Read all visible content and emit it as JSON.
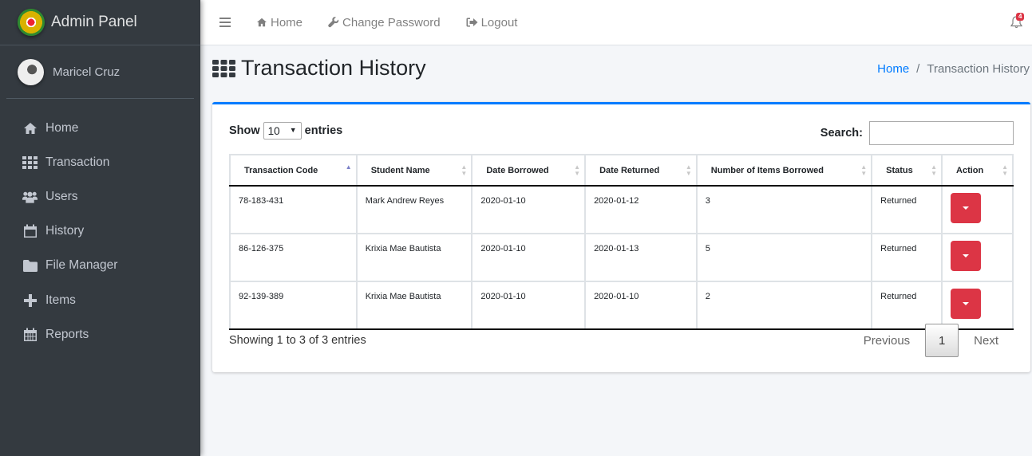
{
  "brand": {
    "title": "Admin Panel",
    "logo": "school-seal-logo"
  },
  "user": {
    "name": "Maricel Cruz",
    "avatar": "user-avatar"
  },
  "sidebar": {
    "items": [
      {
        "label": "Home",
        "icon": "home-icon"
      },
      {
        "label": "Transaction",
        "icon": "grid-icon"
      },
      {
        "label": "Users",
        "icon": "users-icon"
      },
      {
        "label": "History",
        "icon": "calendar-icon"
      },
      {
        "label": "File Manager",
        "icon": "folder-icon"
      },
      {
        "label": "Items",
        "icon": "plus-icon"
      },
      {
        "label": "Reports",
        "icon": "calendar-grid-icon"
      }
    ]
  },
  "topbar": {
    "menu_icon": "hamburger-icon",
    "home": "Home",
    "change_password": "Change Password",
    "logout": "Logout",
    "notifications_count": "4"
  },
  "page": {
    "title": "Transaction History",
    "breadcrumb": {
      "home": "Home",
      "separator": "/",
      "current": "Transaction History"
    }
  },
  "table_controls": {
    "show_label": "Show",
    "entries_value": "10",
    "entries_label": "entries",
    "search_label": "Search:",
    "search_value": ""
  },
  "table": {
    "columns": [
      "Transaction Code",
      "Student Name",
      "Date Borrowed",
      "Date Returned",
      "Number of Items Borrowed",
      "Status",
      "Action"
    ],
    "sorted_column": "Transaction Code",
    "sort_direction": "ascending",
    "rows": [
      {
        "code": "78-183-431",
        "student": "Mark Andrew Reyes",
        "borrowed": "2020-01-10",
        "returned": "2020-01-12",
        "items": "3",
        "status": "Returned"
      },
      {
        "code": "86-126-375",
        "student": "Krixia Mae Bautista",
        "borrowed": "2020-01-10",
        "returned": "2020-01-13",
        "items": "5",
        "status": "Returned"
      },
      {
        "code": "92-139-389",
        "student": "Krixia Mae Bautista",
        "borrowed": "2020-01-10",
        "returned": "2020-01-10",
        "items": "2",
        "status": "Returned"
      }
    ]
  },
  "footer": {
    "info": "Showing 1 to 3 of 3 entries",
    "previous": "Previous",
    "current_page": "1",
    "next": "Next"
  },
  "colors": {
    "primary": "#007bff",
    "danger": "#dc3545",
    "sidebar": "#343a40"
  }
}
